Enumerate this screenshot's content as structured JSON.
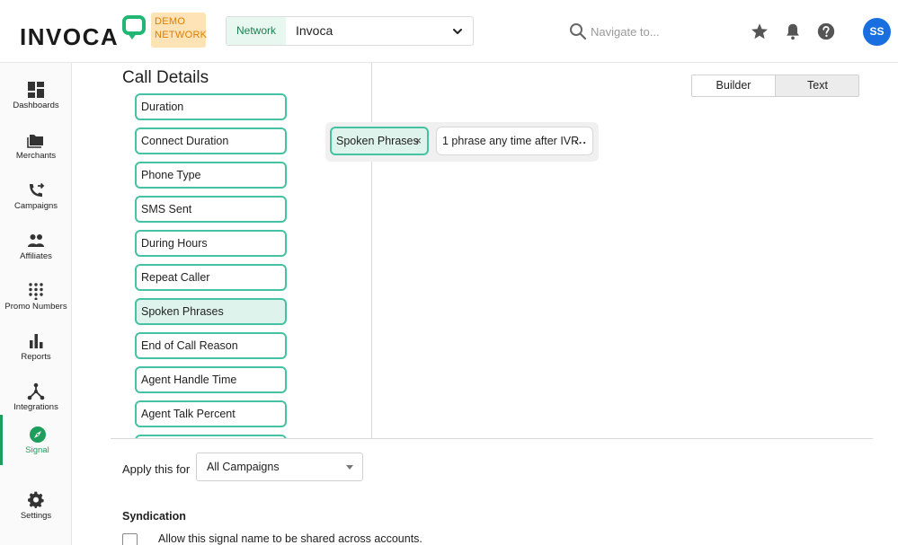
{
  "header": {
    "logo_text": "INVOCA",
    "demo_badge_line1": "DEMO",
    "demo_badge_line2": "NETWORK",
    "network_label": "Network",
    "network_value": "Invoca",
    "search_placeholder": "Navigate to...",
    "avatar_initials": "SS"
  },
  "sidebar": {
    "items": [
      {
        "label": "Dashboards",
        "icon": "dashboard-icon"
      },
      {
        "label": "Merchants",
        "icon": "folder-icon"
      },
      {
        "label": "Campaigns",
        "icon": "phone-forward-icon"
      },
      {
        "label": "Affiliates",
        "icon": "people-icon"
      },
      {
        "label": "Promo Numbers",
        "icon": "dialpad-icon"
      },
      {
        "label": "Reports",
        "icon": "bar-chart-icon"
      },
      {
        "label": "Integrations",
        "icon": "hub-icon"
      },
      {
        "label": "Signal",
        "icon": "compass-icon"
      },
      {
        "label": "Settings",
        "icon": "gear-icon"
      }
    ],
    "active": "Signal"
  },
  "main": {
    "section_title": "Call Details",
    "fields": [
      "Duration",
      "Connect Duration",
      "Phone Type",
      "SMS Sent",
      "During Hours",
      "Repeat Caller",
      "Spoken Phrases",
      "End of Call Reason",
      "Agent Handle Time",
      "Agent Talk Percent"
    ],
    "selected_field": "Spoken Phrases",
    "mode_builder": "Builder",
    "mode_text": "Text",
    "condition_chip": "Spoken Phrases",
    "condition_close": "×",
    "condition_phrase": "1 phrase any time after IVR",
    "condition_more": "...",
    "apply_label": "Apply this for",
    "apply_value": "All Campaigns",
    "syndication_title": "Syndication",
    "syndication_text": "Allow this signal name to be shared across accounts."
  },
  "colors": {
    "accent_teal": "#45c2a2",
    "signal_green": "#1e9e5c",
    "avatar_blue": "#1a6fe0",
    "demo_orange": "#e07d00"
  }
}
